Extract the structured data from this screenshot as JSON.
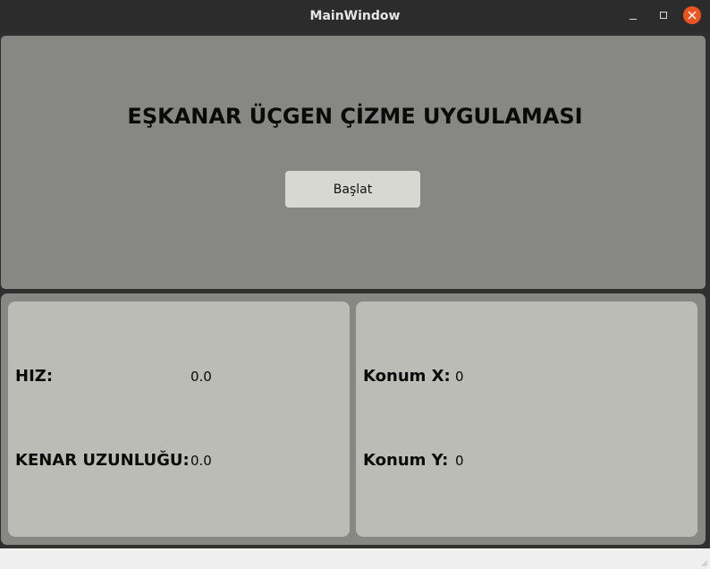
{
  "window": {
    "title": "MainWindow",
    "controls": {
      "minimize_icon": "minimize-icon",
      "maximize_icon": "maximize-icon",
      "close_icon": "close-icon",
      "close_color": "#e95420"
    }
  },
  "header": {
    "app_title": "EŞKANAR ÜÇGEN ÇİZME UYGULAMASI",
    "start_button_label": "Başlat"
  },
  "motion_panel": {
    "speed_label": "HIZ:",
    "speed_value": "0.0",
    "side_length_label": "KENAR UZUNLUĞU:",
    "side_length_value": "0.0"
  },
  "position_panel": {
    "x_label": "Konum X:",
    "x_value": "0",
    "y_label": "Konum Y:",
    "y_value": "0"
  },
  "colors": {
    "panel_bg": "#878883",
    "card_bg": "#babcb5",
    "button_bg": "#d8d8d3",
    "titlebar_bg": "#2c2c2c"
  }
}
